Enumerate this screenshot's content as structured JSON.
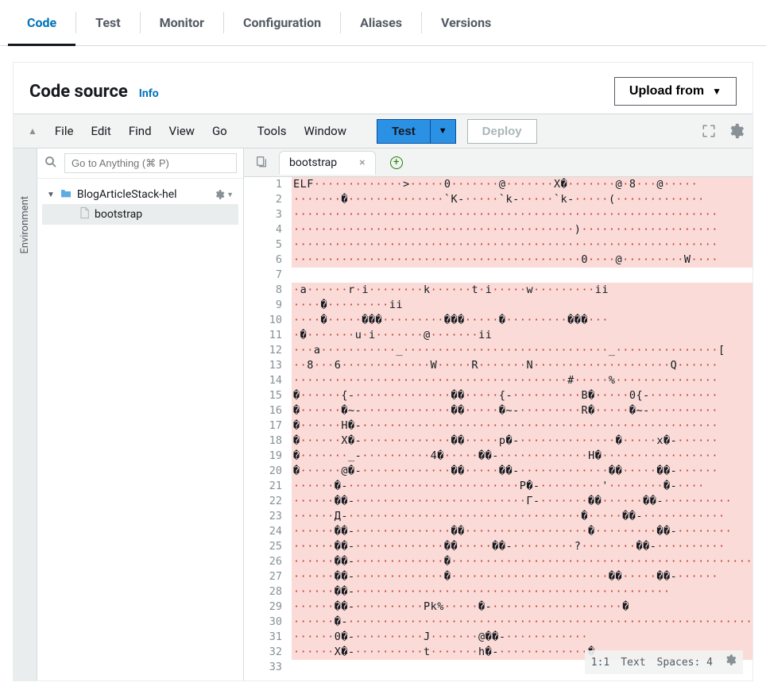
{
  "tabs": [
    "Code",
    "Test",
    "Monitor",
    "Configuration",
    "Aliases",
    "Versions"
  ],
  "activeTab": "Code",
  "panel": {
    "title": "Code source",
    "info": "Info",
    "uploadLabel": "Upload from"
  },
  "menu": {
    "file": "File",
    "edit": "Edit",
    "find": "Find",
    "view": "View",
    "go": "Go",
    "tools": "Tools",
    "window": "Window",
    "test": "Test",
    "deploy": "Deploy"
  },
  "search": {
    "placeholder": "Go to Anything (⌘ P)"
  },
  "sidebar": {
    "label": "Environment",
    "folder": "BlogArticleStack-hel",
    "file": "bootstrap"
  },
  "openTab": "bootstrap",
  "status": {
    "pos": "1:1",
    "mode": "Text",
    "spaces": "Spaces: 4"
  },
  "lines": [
    "ELF·············>·····0·······@·······X�·······@·8···@·····",
    "·······�··············`K-·····`k-·····`k-·····(·············",
    "······························································",
    "·········································)····················",
    "······························································",
    "··········································0····@·········W····",
    "",
    "·a······r·i········k······t·i·····w·········ii",
    "····�·········ii",
    "····�·····���·········���·····�·········���···",
    "·�·······u·i·······@·······ii",
    "···a···········_······························_···············[",
    "··8···6·············W·····R·······N····················Q······",
    "········································#·····%···············",
    "�······{-··············��·····{-··········B�·····0{-··········",
    "�······�~-·············��·····�~-·········R�·····�~-··········",
    "�······H�-····················································",
    "�······X�-·············��·····p�-··············�·····x�-······",
    "�·······_-··········4�·····��-·············H�·················",
    "�······@�-·············��·····��-·············��·····��-······",
    "······�-·························P�-·········'········�-····",
    "······��-·························Г-·······��······��-··········",
    "······Д-··································�·····��-············",
    "······��-··············��··················�·········��-········",
    "······��-·············��·····��-·········?········��-··········",
    "······��-·············�···············································",
    "······��-·············�·······················��·····��-······",
    "······��-··············································",
    "······��-··········Pk%·····�-···················�",
    "······�-·····························································",
    "······0�-··········J·······@��-············",
    "······X�-··········t·······h�-·············�",
    ""
  ]
}
